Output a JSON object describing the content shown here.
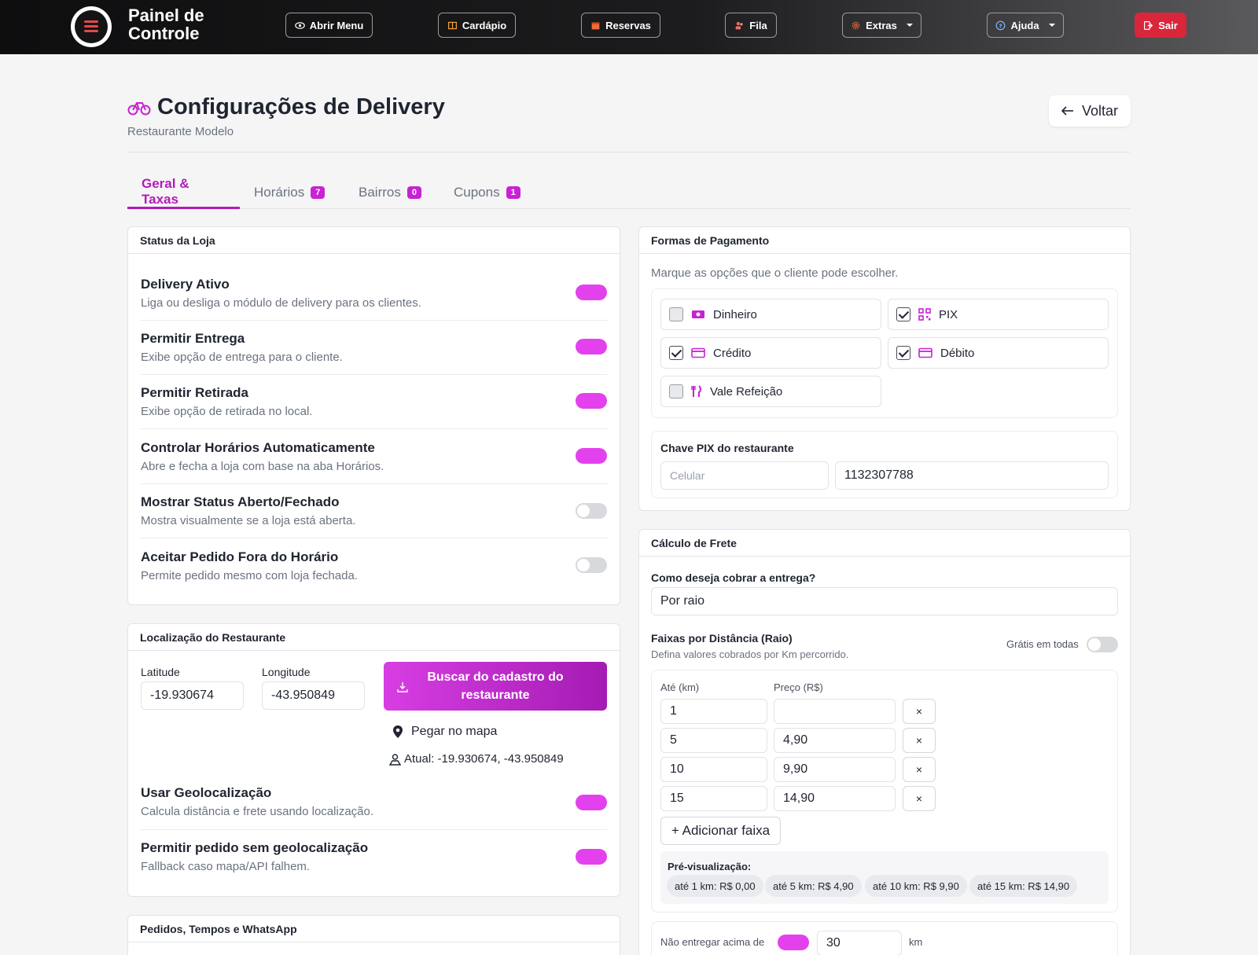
{
  "nav": {
    "brand_line1": "Painel de",
    "brand_line2": "Controle",
    "open_menu": "Abrir Menu",
    "cardapio": "Cardápio",
    "reservas": "Reservas",
    "fila": "Fila",
    "extras": "Extras",
    "ajuda": "Ajuda",
    "sair": "Sair"
  },
  "header": {
    "title": "Configurações de Delivery",
    "subtitle": "Restaurante Modelo",
    "back_label": "Voltar"
  },
  "tabs": [
    {
      "label": "Geral & Taxas",
      "badge": ""
    },
    {
      "label": "Horários",
      "badge": "7"
    },
    {
      "label": "Bairros",
      "badge": "0"
    },
    {
      "label": "Cupons",
      "badge": "1"
    }
  ],
  "store_status": {
    "header": "Status da Loja",
    "items": [
      {
        "title": "Delivery Ativo",
        "desc": "Liga ou desliga o módulo de delivery para os clientes.",
        "on": true
      },
      {
        "title": "Permitir Entrega",
        "desc": "Exibe opção de entrega para o cliente.",
        "on": true
      },
      {
        "title": "Permitir Retirada",
        "desc": "Exibe opção de retirada no local.",
        "on": true
      },
      {
        "title": "Controlar Horários Automaticamente",
        "desc": "Abre e fecha a loja com base na aba Horários.",
        "on": true
      },
      {
        "title": "Mostrar Status Aberto/Fechado",
        "desc": "Mostra visualmente se a loja está aberta.",
        "on": false
      },
      {
        "title": "Aceitar Pedido Fora do Horário",
        "desc": "Permite pedido mesmo com loja fechada.",
        "on": false
      }
    ]
  },
  "location": {
    "header": "Localização do Restaurante",
    "lat_label": "Latitude",
    "lat_value": "-19.930674",
    "lng_label": "Longitude",
    "lng_value": "-43.950849",
    "fetch_line1": "Buscar do cadastro do",
    "fetch_line2": "restaurante",
    "pick_map": "Pegar no mapa",
    "current": "Atual: -19.930674, -43.950849",
    "items": [
      {
        "title": "Usar Geolocalização",
        "desc": "Calcula distância e frete usando localização.",
        "on": true
      },
      {
        "title": "Permitir pedido sem geolocalização",
        "desc": "Fallback caso mapa/API falhem.",
        "on": true
      }
    ]
  },
  "orders": {
    "header": "Pedidos, Tempos e WhatsApp"
  },
  "payment": {
    "header": "Formas de Pagamento",
    "hint": "Marque as opções que o cliente pode escolher.",
    "methods": [
      {
        "label": "Dinheiro",
        "checked": false,
        "icon": "cash-icon"
      },
      {
        "label": "PIX",
        "checked": true,
        "icon": "qr-icon"
      },
      {
        "label": "Crédito",
        "checked": true,
        "icon": "card-icon"
      },
      {
        "label": "Débito",
        "checked": true,
        "icon": "card-icon"
      },
      {
        "label": "Vale Refeição",
        "checked": false,
        "icon": "cutlery-icon"
      }
    ],
    "pix_label": "Chave PIX do restaurante",
    "pix_type": "Celular",
    "pix_key": "1132307788"
  },
  "shipping": {
    "header": "Cálculo de Frete",
    "how_label": "Como deseja cobrar a entrega?",
    "how_value": "Por raio",
    "ranges_title": "Faixas por Distância (Raio)",
    "ranges_desc": "Defina valores cobrados por Km percorrido.",
    "free_all": "Grátis em todas",
    "col_km": "Até (km)",
    "col_price": "Preço (R$)",
    "rows": [
      {
        "km": "1",
        "price": ""
      },
      {
        "km": "5",
        "price": "4,90"
      },
      {
        "km": "10",
        "price": "9,90"
      },
      {
        "km": "15",
        "price": "14,90"
      }
    ],
    "remove_symbol": "×",
    "add_label": "+ Adicionar faixa",
    "preview_label": "Pré-visualização:",
    "chips": [
      "até 1 km: R$ 0,00",
      "até 5 km: R$ 4,90",
      "até 10 km: R$ 9,90",
      "até 15 km: R$ 14,90"
    ],
    "max_label": "Não entregar acima de",
    "max_value": "30",
    "max_unit": "km"
  },
  "colors": {
    "accent": "#c822d4",
    "toggle_on": "#e441ee",
    "exit": "#d9263a"
  }
}
